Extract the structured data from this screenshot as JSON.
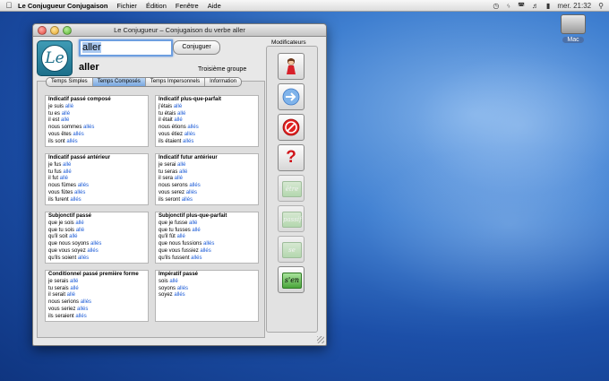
{
  "menubar": {
    "app_name": "Le Conjugueur Conjugaison",
    "menus": [
      "Fichier",
      "Édition",
      "Fenêtre",
      "Aide"
    ],
    "clock": "mer. 21:32"
  },
  "desktop": {
    "disk_label": "Mac"
  },
  "window": {
    "title": "Le Conjugueur – Conjugaison du verbe aller",
    "verb_input_value": "aller",
    "conjugate_button": "Conjuguer",
    "verb_name": "aller",
    "group": "Troisième groupe",
    "logo_letter": "Le",
    "tabs": [
      {
        "label": "Temps Simples",
        "active": false
      },
      {
        "label": "Temps Composés",
        "active": true
      },
      {
        "label": "Temps Impersonnels",
        "active": false
      },
      {
        "label": "Information",
        "active": false
      }
    ],
    "modifiers_title": "Modificateurs",
    "modifiers": [
      {
        "icon": "feminine-person-icon",
        "label": ""
      },
      {
        "icon": "arrow-icon",
        "label": ""
      },
      {
        "icon": "negation-icon",
        "label": ""
      },
      {
        "icon": "question-icon",
        "label": "?"
      },
      {
        "icon": "auxiliary-etre-icon",
        "label": "être"
      },
      {
        "icon": "auxiliary-passif-icon",
        "label": "passif"
      },
      {
        "icon": "auxiliary-se-icon",
        "label": "se"
      },
      {
        "icon": "auxiliary-sen-icon",
        "label": "s'en"
      }
    ],
    "tenses": [
      {
        "title": "Indicatif passé composé",
        "lines": [
          [
            "je suis ",
            "allé"
          ],
          [
            "tu es ",
            "allé"
          ],
          [
            "il est ",
            "allé"
          ],
          [
            "nous sommes ",
            "allés"
          ],
          [
            "vous êtes ",
            "allés"
          ],
          [
            "ils sont ",
            "allés"
          ]
        ]
      },
      {
        "title": "Indicatif plus-que-parfait",
        "lines": [
          [
            "j'étais ",
            "allé"
          ],
          [
            "tu étais ",
            "allé"
          ],
          [
            "il était ",
            "allé"
          ],
          [
            "nous étions ",
            "allés"
          ],
          [
            "vous étiez ",
            "allés"
          ],
          [
            "ils étaient ",
            "allés"
          ]
        ]
      },
      {
        "title": "Indicatif passé antérieur",
        "lines": [
          [
            "je fus ",
            "allé"
          ],
          [
            "tu fus ",
            "allé"
          ],
          [
            "il fut ",
            "allé"
          ],
          [
            "nous fûmes ",
            "allés"
          ],
          [
            "vous fûtes ",
            "allés"
          ],
          [
            "ils furent ",
            "allés"
          ]
        ]
      },
      {
        "title": "Indicatif futur antérieur",
        "lines": [
          [
            "je serai ",
            "allé"
          ],
          [
            "tu seras ",
            "allé"
          ],
          [
            "il sera ",
            "allé"
          ],
          [
            "nous serons ",
            "allés"
          ],
          [
            "vous serez ",
            "allés"
          ],
          [
            "ils seront ",
            "allés"
          ]
        ]
      },
      {
        "title": "Subjonctif passé",
        "lines": [
          [
            "que je sois ",
            "allé"
          ],
          [
            "que tu sois ",
            "allé"
          ],
          [
            "qu'il soit ",
            "allé"
          ],
          [
            "que nous soyons ",
            "allés"
          ],
          [
            "que vous soyez ",
            "allés"
          ],
          [
            "qu'ils soient ",
            "allés"
          ]
        ]
      },
      {
        "title": "Subjonctif plus-que-parfait",
        "lines": [
          [
            "que je fusse ",
            "allé"
          ],
          [
            "que tu fusses ",
            "allé"
          ],
          [
            "qu'il fût ",
            "allé"
          ],
          [
            "que nous fussions ",
            "allés"
          ],
          [
            "que vous fussiez ",
            "allés"
          ],
          [
            "qu'ils fussent ",
            "allés"
          ]
        ]
      },
      {
        "title": "Conditionnel passé première forme",
        "lines": [
          [
            "je serais ",
            "allé"
          ],
          [
            "tu serais ",
            "allé"
          ],
          [
            "il serait ",
            "allé"
          ],
          [
            "nous serions ",
            "allés"
          ],
          [
            "vous seriez ",
            "allés"
          ],
          [
            "ils seraient ",
            "allés"
          ]
        ]
      },
      {
        "title": "Impératif passé",
        "lines": [
          [
            "sois ",
            "allé"
          ],
          [
            "soyons ",
            "allés"
          ],
          [
            "soyez ",
            "allés"
          ]
        ]
      }
    ]
  }
}
